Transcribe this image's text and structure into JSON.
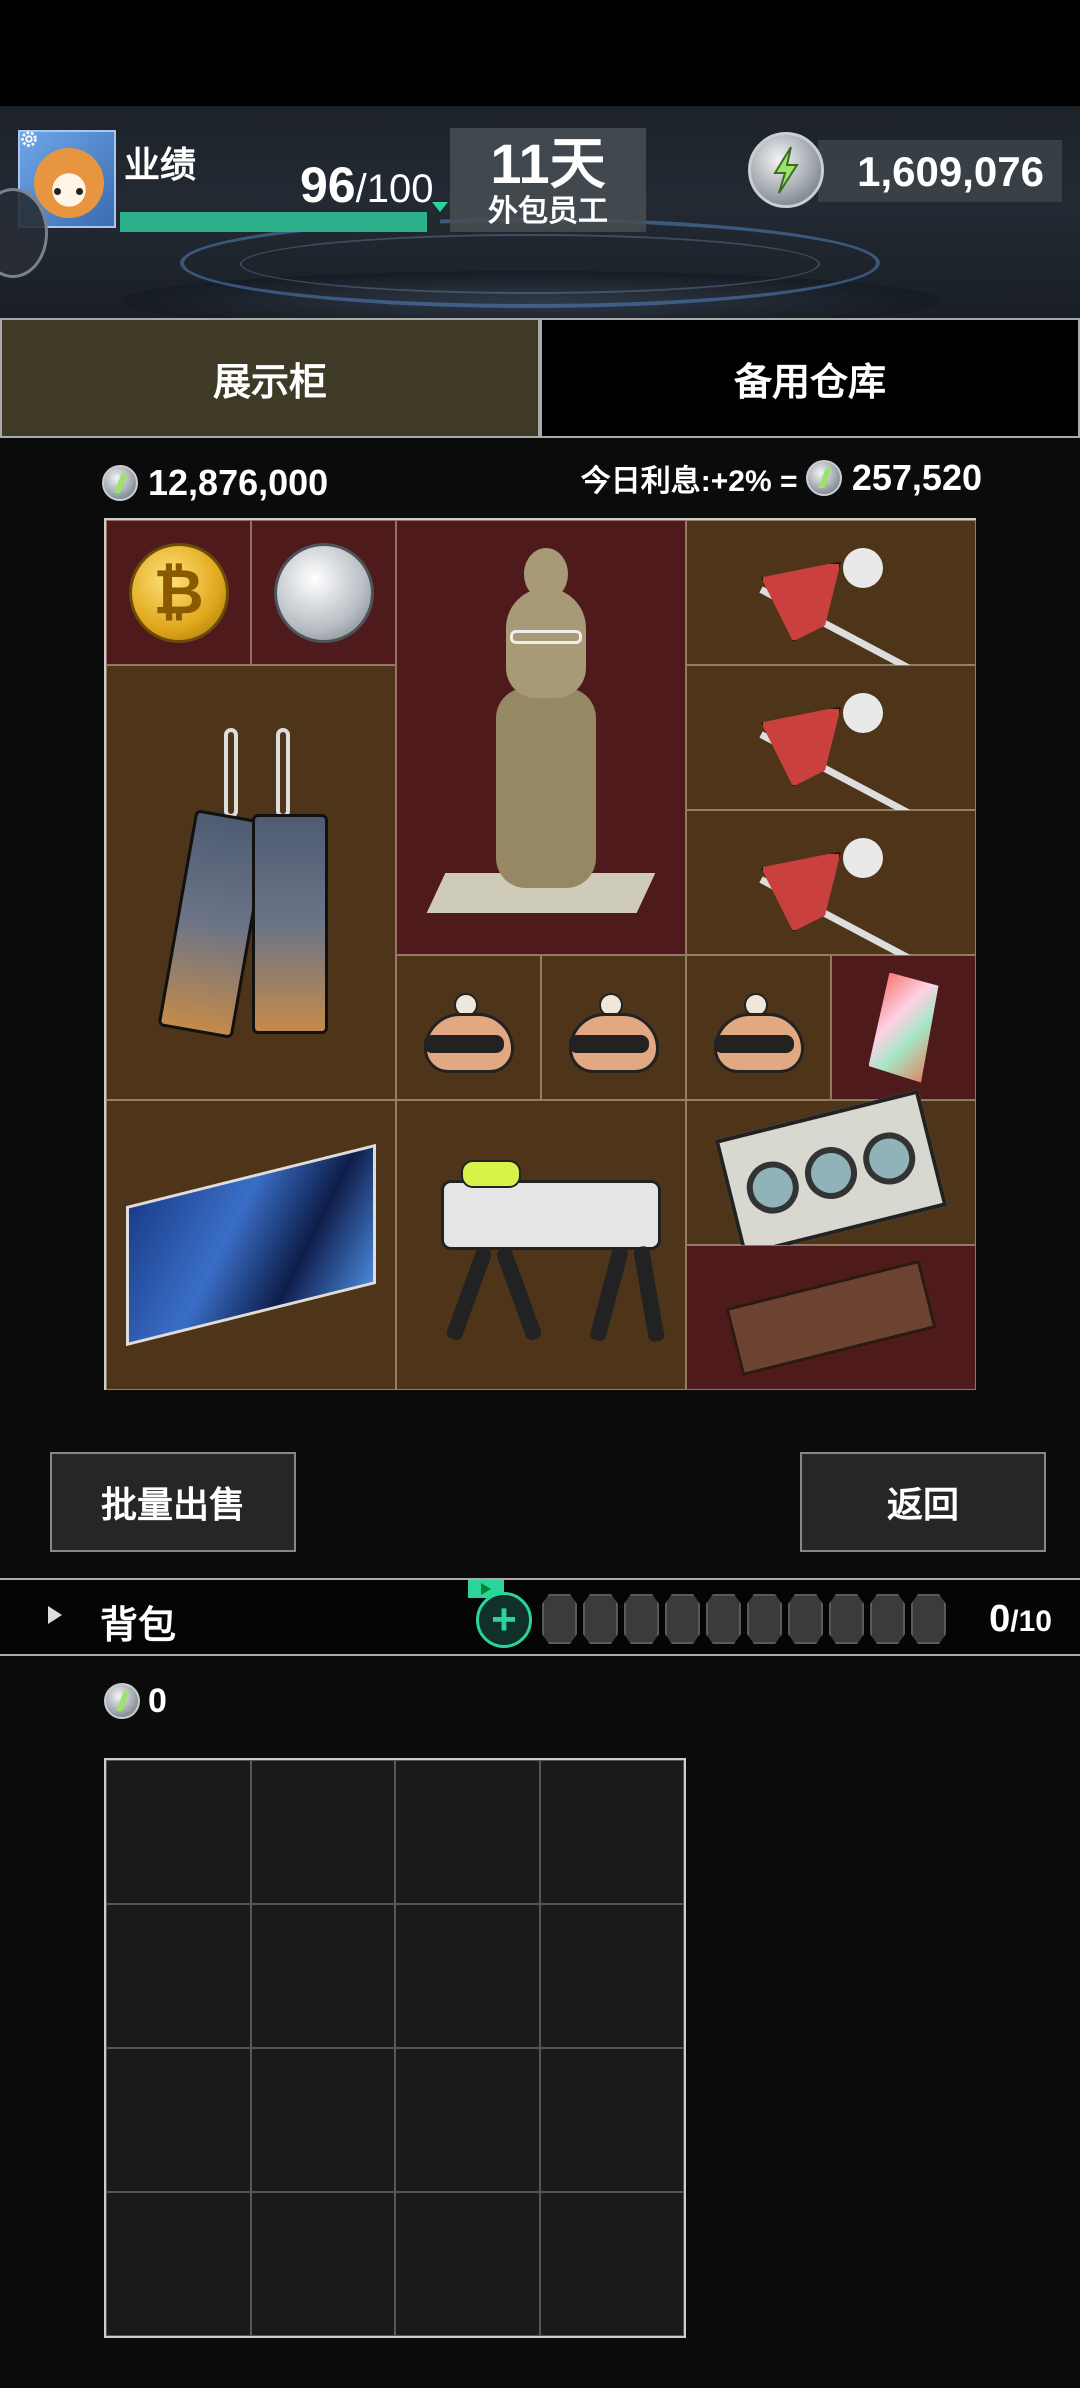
{
  "header": {
    "performance_label": "业绩",
    "performance_value": "96",
    "performance_max": "/100",
    "performance_fraction": 0.96,
    "days": "11天",
    "role": "外包员工",
    "money": "1,609,076",
    "icons": [
      "gear-icon",
      "shiba-avatar",
      "energy-coin-icon"
    ]
  },
  "tabs": {
    "display_case": "展示柜",
    "spare_warehouse": "备用仓库",
    "active": "display_case"
  },
  "vault": {
    "total_value": "12,876,000",
    "interest_label": "今日利息:+2% =",
    "interest_value": "257,520"
  },
  "display_items": [
    {
      "name": "bitcoin",
      "icon": "bitcoin-coin-icon"
    },
    {
      "name": "silver-coin",
      "icon": "silver-coin-icon"
    },
    {
      "name": "alpaca-statue",
      "icon": "statue-icon"
    },
    {
      "name": "red-gem-pick",
      "icon": "pick-icon"
    },
    {
      "name": "red-gem-pick",
      "icon": "pick-icon"
    },
    {
      "name": "red-gem-pick",
      "icon": "pick-icon"
    },
    {
      "name": "overalls",
      "icon": "pants-icon"
    },
    {
      "name": "visor-helmet",
      "icon": "helmet-icon"
    },
    {
      "name": "visor-helmet",
      "icon": "helmet-icon"
    },
    {
      "name": "visor-helmet",
      "icon": "helmet-icon"
    },
    {
      "name": "prism-crystal",
      "icon": "crystal-icon"
    },
    {
      "name": "graphics-card",
      "icon": "gpu-icon"
    },
    {
      "name": "star-map",
      "icon": "map-icon"
    },
    {
      "name": "robot-dog",
      "icon": "robot-dog-icon"
    },
    {
      "name": "wooden-box",
      "icon": "box-icon"
    }
  ],
  "buttons": {
    "bulk_sell": "批量出售",
    "back": "返回"
  },
  "backpack": {
    "label": "背包",
    "count": "0",
    "max": "/10",
    "slots": 10,
    "total_value": "0"
  },
  "colors": {
    "accent_green": "#2bd49a",
    "tab_active": "#3e3a26",
    "cell_brown": "#4e3519",
    "cell_maroon": "#4f1a1c"
  }
}
